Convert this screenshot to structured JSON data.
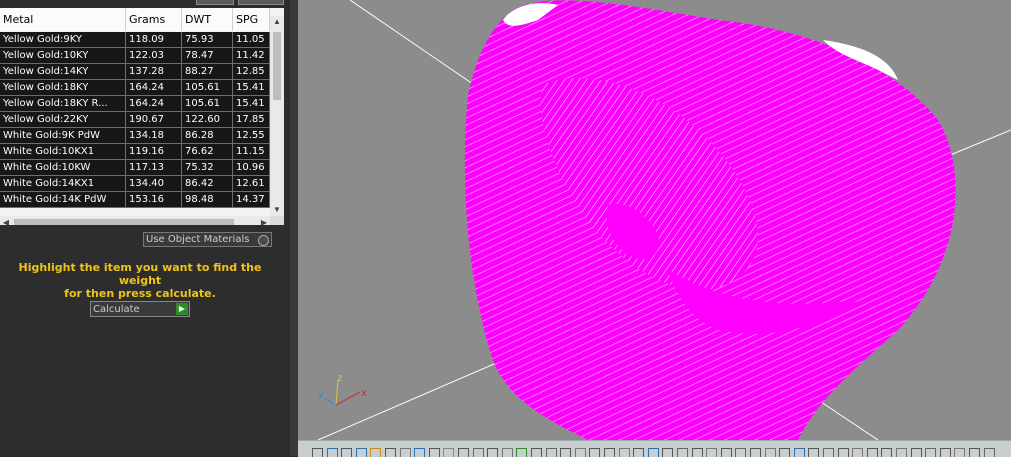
{
  "table": {
    "headers": [
      "Metal",
      "Grams",
      "DWT",
      "SPG"
    ],
    "rows": [
      [
        "Yellow Gold:9KY",
        "118.09",
        "75.93",
        "11.05"
      ],
      [
        "Yellow Gold:10KY",
        "122.03",
        "78.47",
        "11.42"
      ],
      [
        "Yellow Gold:14KY",
        "137.28",
        "88.27",
        "12.85"
      ],
      [
        "Yellow Gold:18KY",
        "164.24",
        "105.61",
        "15.41"
      ],
      [
        "Yellow Gold:18KY R...",
        "164.24",
        "105.61",
        "15.41"
      ],
      [
        "Yellow Gold:22KY",
        "190.67",
        "122.60",
        "17.85"
      ],
      [
        "White Gold:9K PdW",
        "134.18",
        "86.28",
        "12.55"
      ],
      [
        "White Gold:10KX1",
        "119.16",
        "76.62",
        "11.15"
      ],
      [
        "White Gold:10KW",
        "117.13",
        "75.32",
        "10.96"
      ],
      [
        "White Gold:14KX1",
        "134.40",
        "86.42",
        "12.61"
      ],
      [
        "White Gold:14K PdW",
        "153.16",
        "98.48",
        "14.37"
      ]
    ]
  },
  "options": {
    "use_object_materials": "Use Object Materials"
  },
  "hint": {
    "line1": "Highlight the item you want to find the weight",
    "line2": "for then press calculate."
  },
  "calculate": {
    "label": "Calculate"
  },
  "axis": {
    "y": "y",
    "z": "z",
    "x": "x"
  },
  "colors": {
    "mesh": "#ff00ff",
    "hint_text": "#f0c419",
    "viewport_bg": "#8c8c8c",
    "row_bg": "#171717"
  }
}
